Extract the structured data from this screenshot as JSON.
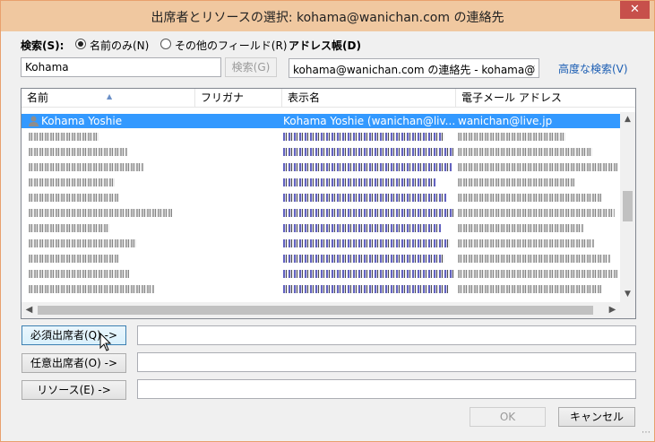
{
  "window": {
    "title": "出席者とリソースの選択: kohama@wanichan.com の連絡先",
    "close_glyph": "✕"
  },
  "search": {
    "label": "検索(S):",
    "radio_name_only": "名前のみ(N)",
    "radio_other_fields": "その他のフィールド(R)",
    "selected_radio": "name_only",
    "input_value": "Kohama",
    "button_label": "検索(G)"
  },
  "address_book": {
    "label": "アドレス帳(D)",
    "selected_value": "kohama@wanichan.com の連絡先 - kohama@",
    "advanced_search_link": "高度な検索(V)"
  },
  "contacts_table": {
    "columns": [
      "名前",
      "フリガナ",
      "表示名",
      "電子メール アドレス"
    ],
    "sort_column": "名前",
    "selected_row": {
      "name": "Kohama Yoshie",
      "furigana": "",
      "display_name": "Kohama Yoshie (wanichan@liv...",
      "email": "wanichan@live.jp"
    },
    "hidden_row_count": 12
  },
  "recipients": {
    "required_button": "必須出席者(Q) ->",
    "required_value": "",
    "optional_button": "任意出席者(O) ->",
    "optional_value": "",
    "resources_button": "リソース(E) ->",
    "resources_value": ""
  },
  "footer": {
    "ok_label": "OK",
    "cancel_label": "キャンセル"
  },
  "colors": {
    "titlebar": "#f0c8a0",
    "selection": "#3399ff",
    "close_button": "#c7504b",
    "link": "#1a5db3"
  }
}
